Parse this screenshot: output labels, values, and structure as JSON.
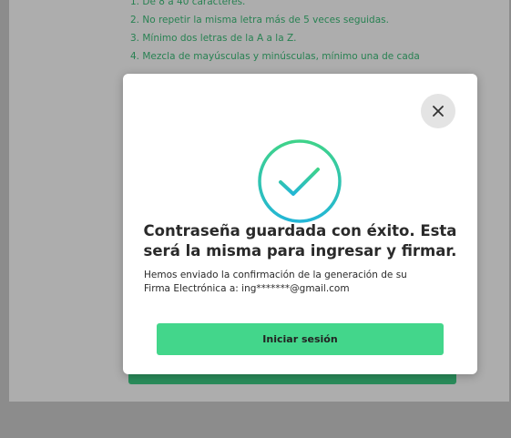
{
  "background": {
    "rules": [
      "1. De 8 a 40 caracteres.",
      "2. No repetir la misma letra más de 5 veces seguidas.",
      "3. Mínimo dos letras de la A a la Z.",
      "4. Mezcla de mayúsculas y minúsculas, mínimo una de cada"
    ]
  },
  "modal": {
    "close_icon": "close-icon",
    "success_icon": "check-circle-icon",
    "title_line1": "Contraseña guardada con éxito. Esta",
    "title_line2": "será la misma para ingresar y firmar.",
    "message_line1": "Hemos enviado la confirmación de la generación de su",
    "message_line2": "Firma Electrónica a: ing*******@gmail.com",
    "button_label": "Iniciar sesión"
  },
  "colors": {
    "accent": "#43d68b",
    "check_gradient_start": "#3fd38a",
    "check_gradient_end": "#23b6d6",
    "rules_text": "#3cbf7a"
  }
}
